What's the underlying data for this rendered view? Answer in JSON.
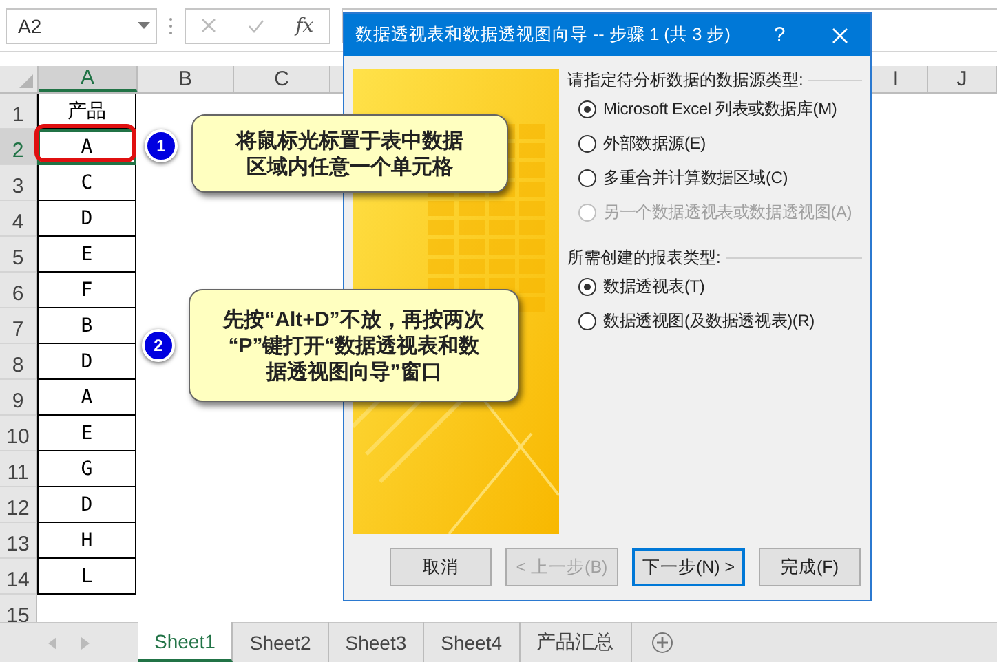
{
  "name_box": {
    "value": "A2"
  },
  "formula_bar": {
    "function_label": "fx"
  },
  "columns_left": [
    {
      "label": "A",
      "selected": true
    },
    {
      "label": "B",
      "selected": false
    },
    {
      "label": "C",
      "selected": false
    }
  ],
  "columns_right": [
    {
      "label": "I"
    },
    {
      "label": "J"
    }
  ],
  "rows": [
    {
      "number": "1",
      "cell": "产品",
      "selected": false
    },
    {
      "number": "2",
      "cell": "A",
      "selected": true
    },
    {
      "number": "3",
      "cell": "C",
      "selected": false
    },
    {
      "number": "4",
      "cell": "D",
      "selected": false
    },
    {
      "number": "5",
      "cell": "E",
      "selected": false
    },
    {
      "number": "6",
      "cell": "F",
      "selected": false
    },
    {
      "number": "7",
      "cell": "B",
      "selected": false
    },
    {
      "number": "8",
      "cell": "D",
      "selected": false
    },
    {
      "number": "9",
      "cell": "A",
      "selected": false
    },
    {
      "number": "10",
      "cell": "E",
      "selected": false
    },
    {
      "number": "11",
      "cell": "G",
      "selected": false
    },
    {
      "number": "12",
      "cell": "D",
      "selected": false
    },
    {
      "number": "13",
      "cell": "H",
      "selected": false
    },
    {
      "number": "14",
      "cell": "L",
      "selected": false
    },
    {
      "number": "15",
      "selected": false
    }
  ],
  "sheet_tabs": [
    {
      "label": "Sheet1",
      "selected": true
    },
    {
      "label": "Sheet2",
      "selected": false
    },
    {
      "label": "Sheet3",
      "selected": false
    },
    {
      "label": "Sheet4",
      "selected": false
    },
    {
      "label": "产品汇总",
      "selected": false
    }
  ],
  "callouts": [
    {
      "number": "1",
      "lines": [
        "将鼠标光标置于表中数据",
        "区域内任意一个单元格"
      ]
    },
    {
      "number": "2",
      "lines": [
        "先按“Alt+D”不放，再按两次",
        "“P”键打开“数据透视表和数",
        "据透视图向导”窗口"
      ]
    }
  ],
  "dialog": {
    "title": "数据透视表和数据透视图向导 -- 步骤 1 (共 3 步)",
    "help": "?",
    "groups": [
      {
        "label": "请指定待分析数据的数据源类型:",
        "options": [
          {
            "label": "Microsoft Excel 列表或数据库(M)",
            "selected": true,
            "disabled": false
          },
          {
            "label": "外部数据源(E)",
            "selected": false,
            "disabled": false
          },
          {
            "label": "多重合并计算数据区域(C)",
            "selected": false,
            "disabled": false
          },
          {
            "label": "另一个数据透视表或数据透视图(A)",
            "selected": false,
            "disabled": true
          }
        ]
      },
      {
        "label": "所需创建的报表类型:",
        "options": [
          {
            "label": "数据透视表(T)",
            "selected": true,
            "disabled": false
          },
          {
            "label": "数据透视图(及数据透视表)(R)",
            "selected": false,
            "disabled": false
          }
        ]
      }
    ],
    "buttons": [
      {
        "label": "取消",
        "disabled": false,
        "default": false
      },
      {
        "label": "< 上一步(B)",
        "disabled": true,
        "default": false
      },
      {
        "label": "下一步(N) >",
        "disabled": false,
        "default": true
      },
      {
        "label": "完成(F)",
        "disabled": false,
        "default": false
      }
    ]
  }
}
